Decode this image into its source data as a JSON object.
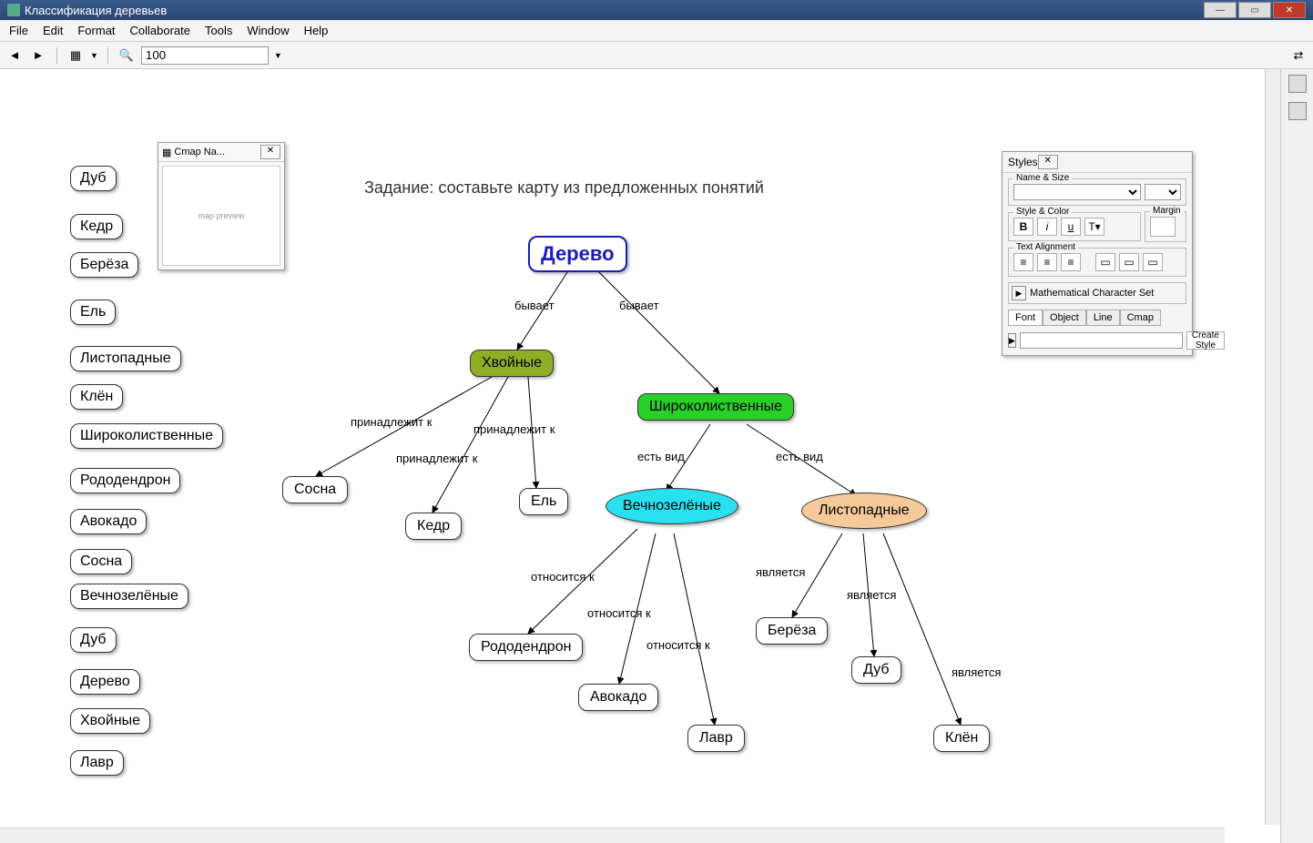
{
  "window": {
    "title": "Классификация деревьев"
  },
  "menu": {
    "file": "File",
    "edit": "Edit",
    "format": "Format",
    "collaborate": "Collaborate",
    "tools": "Tools",
    "window": "Window",
    "help": "Help"
  },
  "toolbar": {
    "zoom": "100"
  },
  "task": {
    "text": "Задание: составьте карту из предложенных понятий"
  },
  "sidebar": {
    "items": [
      "Дуб",
      "Кедр",
      "Берёза",
      "Ель",
      "Листопадные",
      "Клён",
      "Широколиственные",
      "Рододендрон",
      "Авокадо",
      "Сосна",
      "Вечнозелёные",
      "Дуб",
      "Дерево",
      "Хвойные",
      "Лавр"
    ]
  },
  "nodes": {
    "root": "Дерево",
    "khvoynye": "Хвойные",
    "shiroko": "Широколиственные",
    "vechno": "Вечнозелёные",
    "listopad": "Листопадные",
    "sosna": "Сосна",
    "kedr": "Кедр",
    "el": "Ель",
    "rododendron": "Рододендрон",
    "avokado": "Авокадо",
    "lavr": "Лавр",
    "bereza": "Берёза",
    "dub": "Дуб",
    "klen": "Клён"
  },
  "links": {
    "byvaet": "бывает",
    "prinadlezhit": "принадлежит к",
    "estvid": "есть вид",
    "otnositsya": "относится к",
    "yavlyaetsya": "является"
  },
  "nav": {
    "title": "Cmap Na..."
  },
  "styles": {
    "title": "Styles",
    "name_size": "Name & Size",
    "style_color": "Style & Color",
    "margin": "Margin",
    "text_align": "Text Alignment",
    "math": "Mathematical Character Set",
    "tab_font": "Font",
    "tab_object": "Object",
    "tab_line": "Line",
    "tab_cmap": "Cmap",
    "create": "Create Style"
  }
}
